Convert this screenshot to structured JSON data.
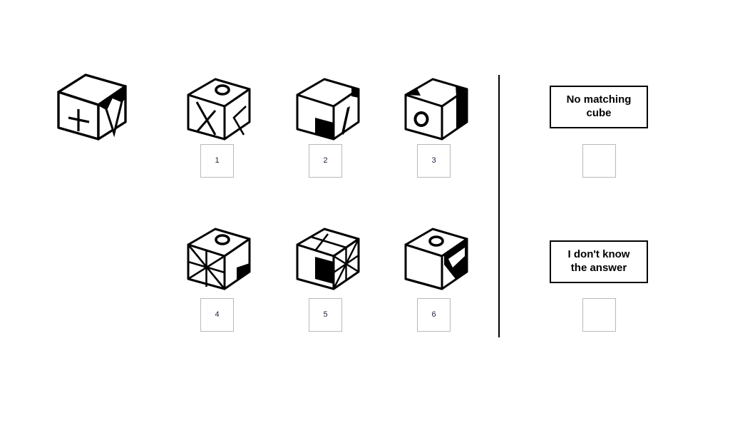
{
  "page": {
    "background": "#ffffff",
    "divider_color": "#000000"
  },
  "reference": {
    "name": "reference-cube",
    "top_face": "blank",
    "front_face": "plus-cross",
    "right_face": "kite-outline"
  },
  "options": [
    {
      "id": "1",
      "label": "1",
      "top_face": "ring-ellipse",
      "front_face": "hourglass-x",
      "right_face": "triangle-outline"
    },
    {
      "id": "2",
      "label": "2",
      "top_face": "blank",
      "front_face": "black-square-bottom-right",
      "right_face": "needle-spike"
    },
    {
      "id": "3",
      "label": "3",
      "top_face": "black-corner-wedges",
      "front_face": "ring-ellipse",
      "right_face": "black-band"
    },
    {
      "id": "4",
      "label": "4",
      "top_face": "ring-ellipse",
      "front_face": "pinwheel-star",
      "right_face": "black-lower-wedge"
    },
    {
      "id": "5",
      "label": "5",
      "top_face": "quad-grid",
      "front_face": "black-square-center",
      "right_face": "radial-fan"
    },
    {
      "id": "6",
      "label": "6",
      "top_face": "ring-ellipse",
      "front_face": "blank",
      "right_face": "black-diagonal-band"
    }
  ],
  "choices": [
    {
      "id": "no-matching-cube",
      "label": "No matching cube"
    },
    {
      "id": "i-dont-know",
      "label": "I don't know\nthe answer"
    }
  ],
  "colors": {
    "ink": "#000000",
    "box_border": "#b9b9b9",
    "number_text": "#2b2140"
  }
}
